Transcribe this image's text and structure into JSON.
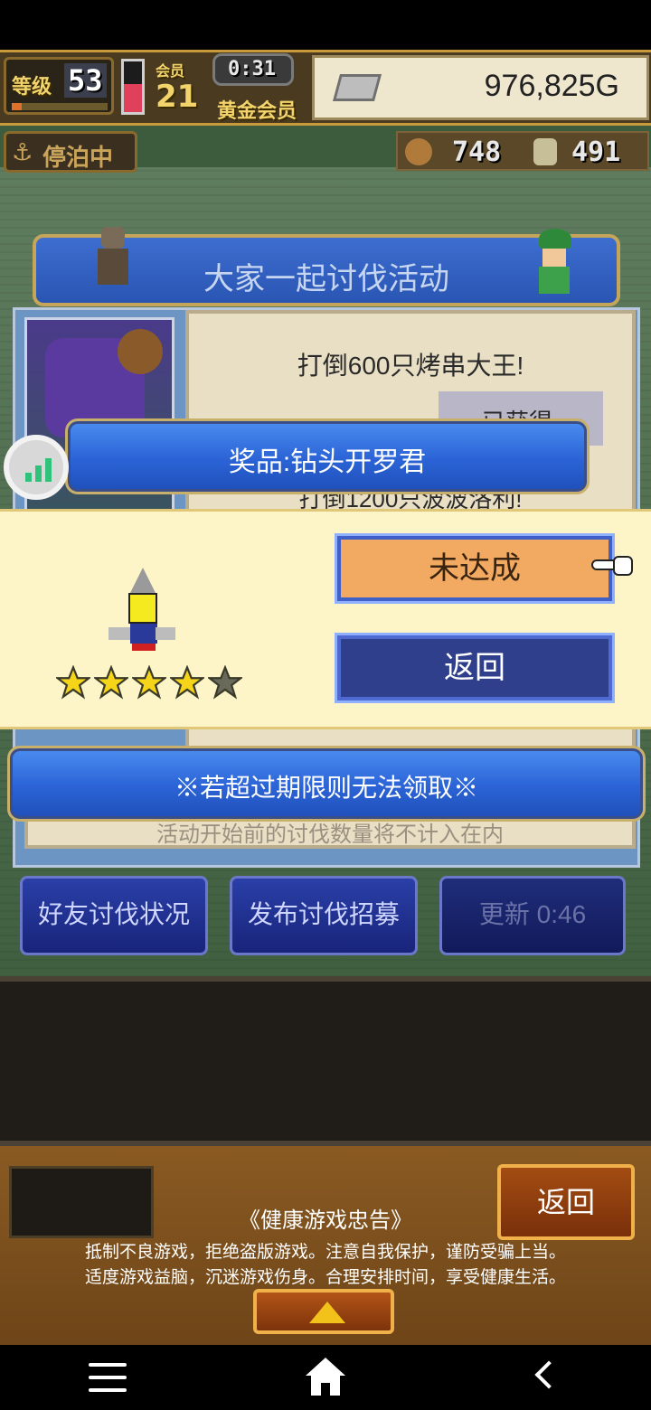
{
  "hud": {
    "level_label": "等级",
    "level_value": "53",
    "rank_label": "会员",
    "rank_value": "21",
    "timer": "0:31",
    "membership": "黄金会员",
    "money": "976,825G",
    "docked": "停泊中",
    "resource_a": "748",
    "resource_b": "491"
  },
  "event": {
    "title": "大家一起讨伐活动",
    "goal1": "打倒600只烤串大王!",
    "obtained": "已获得",
    "goal2": "打倒1200只波波洛利!",
    "note": "活动开始前的讨伐数量将不计入在内"
  },
  "modal": {
    "title": "奖品:钻头开罗君",
    "status_button": "未达成",
    "return_button": "返回",
    "stars_filled": 4,
    "stars_total": 5,
    "notice": "※若超过期限则无法领取※"
  },
  "actions": {
    "friends": "好友讨伐状况",
    "recruit": "发布讨伐招募",
    "refresh": "更新 0:46"
  },
  "footer": {
    "return": "返回",
    "advice_title": "《健康游戏忠告》",
    "advice_line1": "抵制不良游戏，拒绝盗版游戏。注意自我保护，谨防受骗上当。",
    "advice_line2": "适度游戏益脑，沉迷游戏伤身。合理安排时间，享受健康生活。"
  },
  "icons": {
    "nav_menu": "menu-icon",
    "nav_home": "home-icon",
    "nav_back": "back-icon",
    "floating": "signal-bars-icon"
  }
}
